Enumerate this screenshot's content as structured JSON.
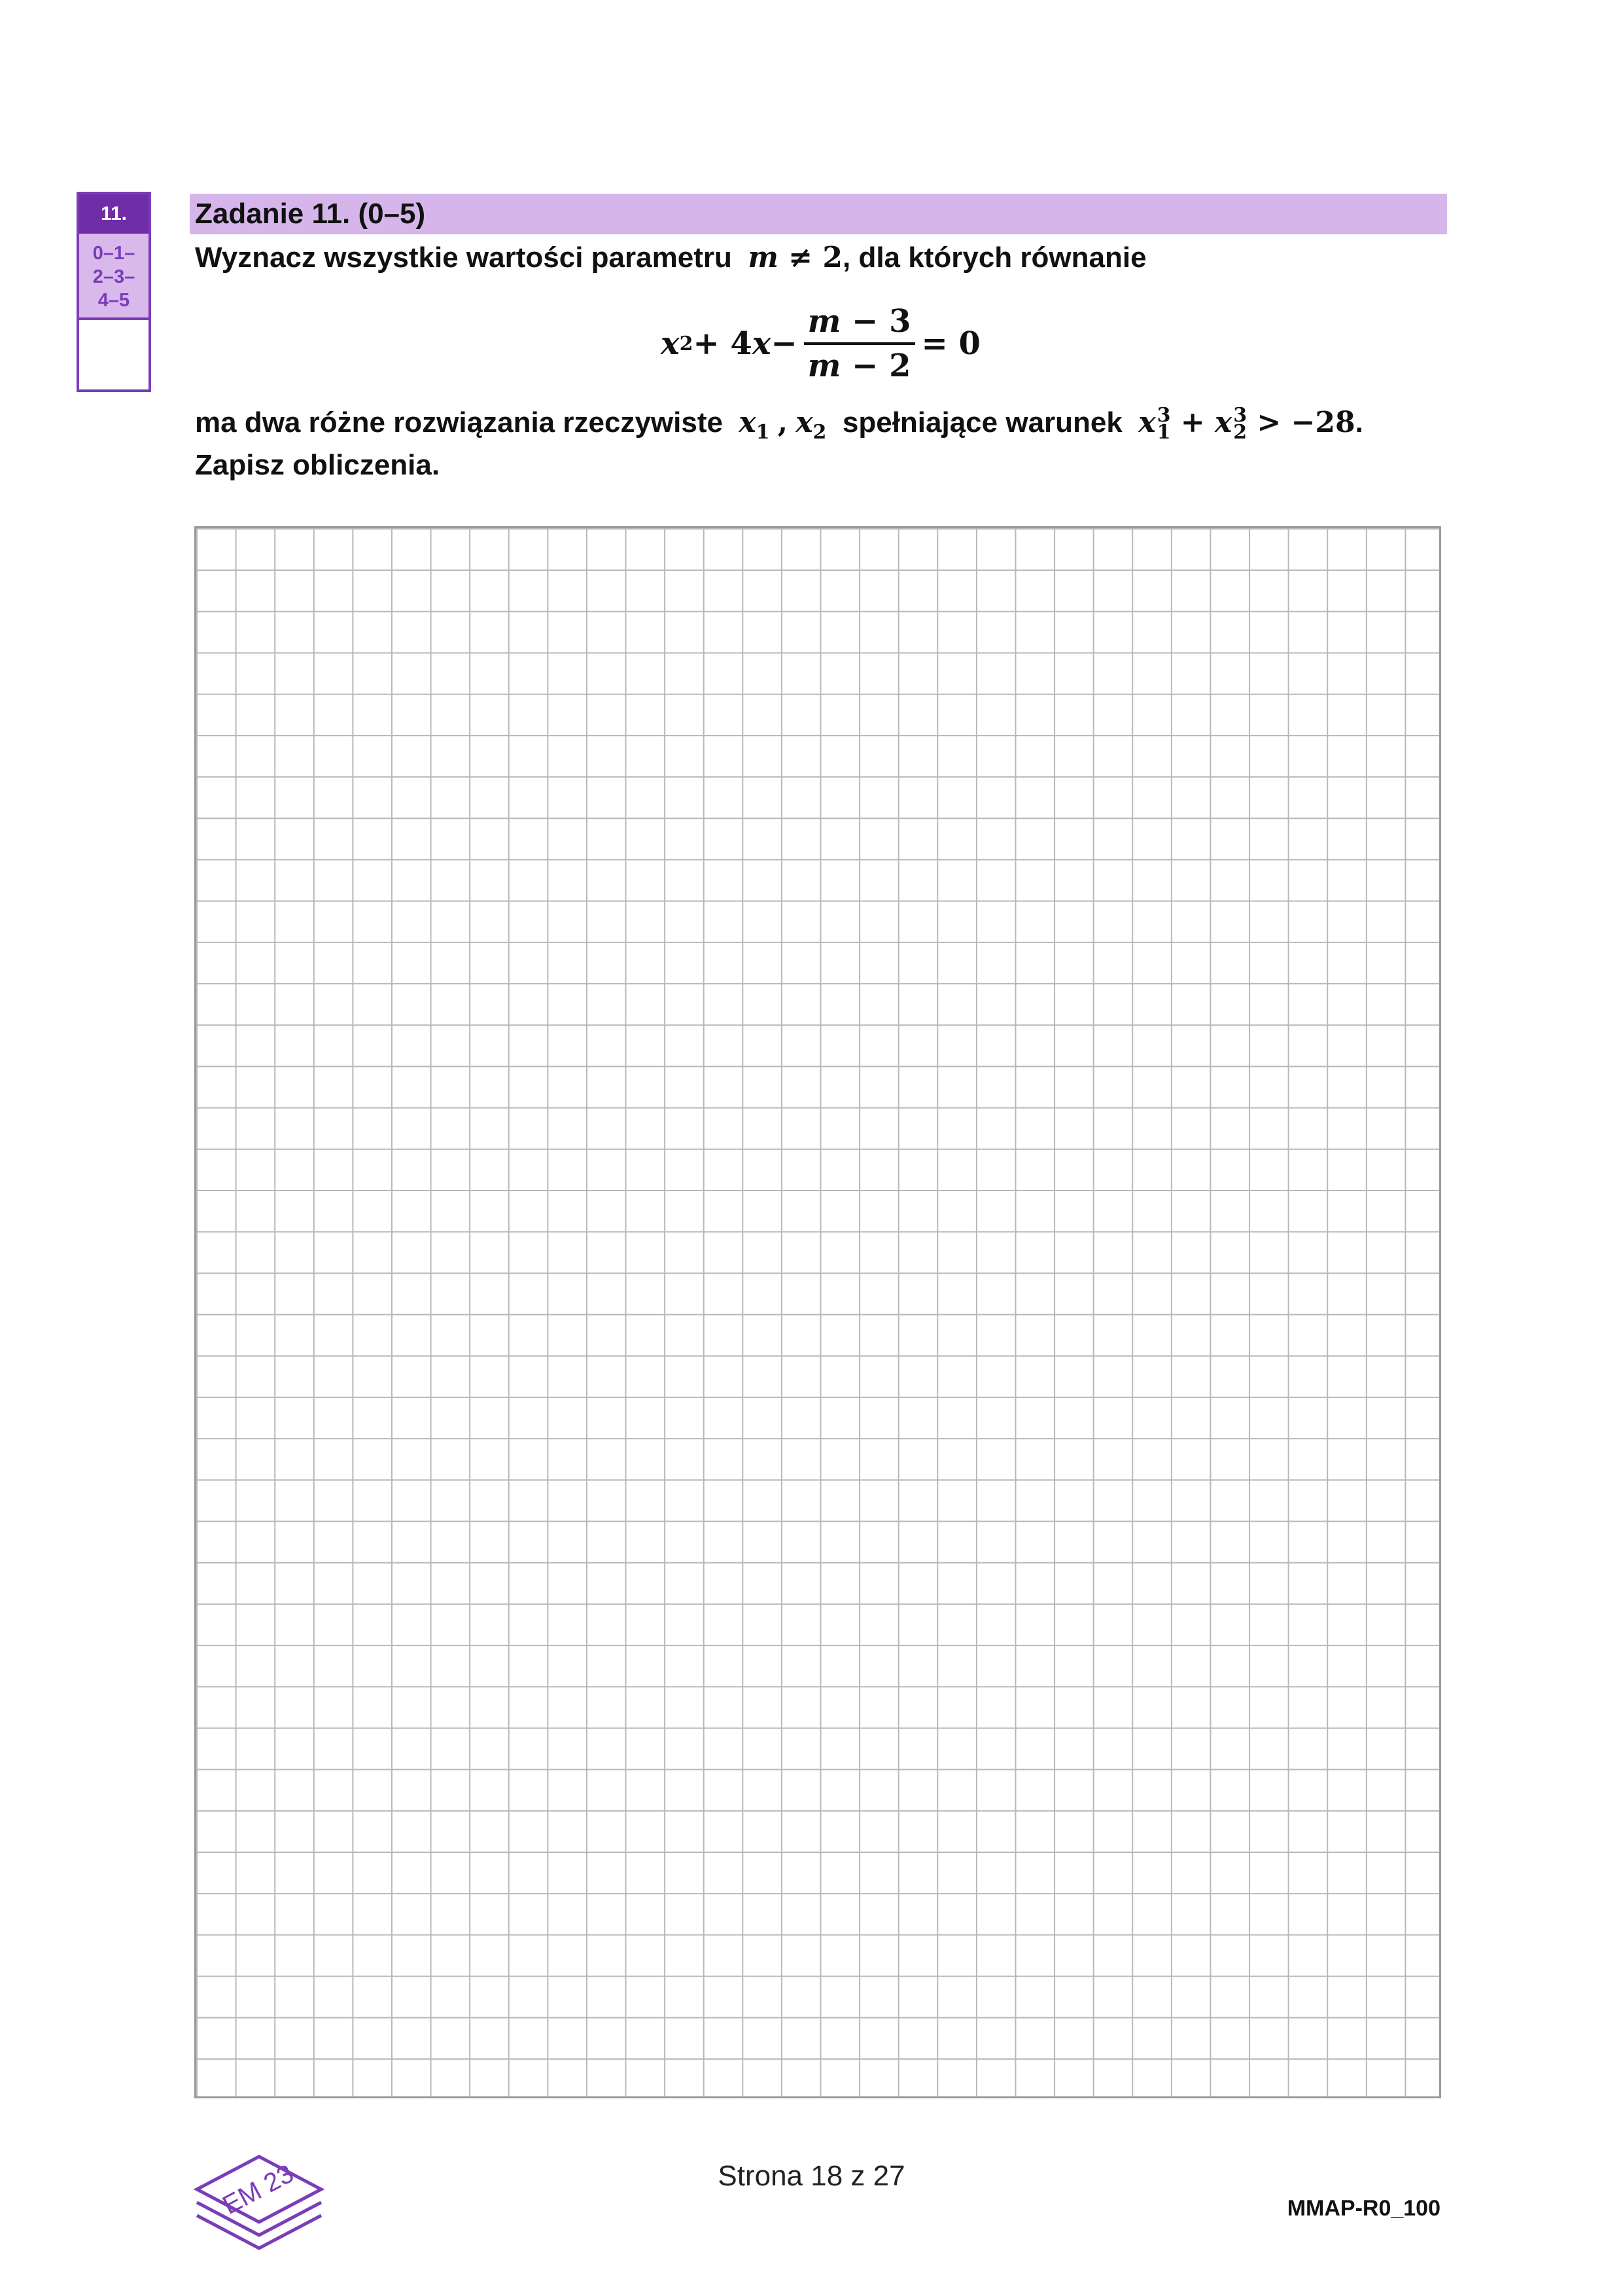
{
  "score": {
    "number": "11.",
    "ranges": [
      "0–1–",
      "2–3–",
      "4–5"
    ]
  },
  "task": {
    "header": "Zadanie 11. (0–5)",
    "line1_prefix": "Wyznacz wszystkie wartości parametru",
    "line1_math_m": "m",
    "line1_math_neq": " ≠ 2",
    "line1_suffix": ", dla których równanie",
    "equation": {
      "lhs_x": "x",
      "lhs_sq": "2",
      "lhs_mid": " + 4",
      "lhs_x2": "x",
      "minus": " −",
      "num_m": "m",
      "num_rest": " − 3",
      "den_m": "m",
      "den_rest": " − 2",
      "rhs": "= 0"
    },
    "line2_prefix": "ma dwa różne rozwiązania rzeczywiste",
    "x1": "x",
    "x1_sub": "1",
    "comma": ",",
    "x2": "x",
    "x2_sub": "2",
    "line2_mid": "spełniające warunek",
    "cond_x1": "x",
    "cond_x1_sup": "3",
    "cond_x1_sub": "1",
    "cond_plus": " + ",
    "cond_x2": "x",
    "cond_x2_sup": "3",
    "cond_x2_sub": "2",
    "cond_rest": " > −28",
    "line2_end": ".",
    "line3": "Zapisz obliczenia."
  },
  "footer": {
    "page": "Strona 18 z 27",
    "code": "MMAP-R0_100",
    "logo_text": "EM 23"
  },
  "colors": {
    "accent": "#6f2da8",
    "header_bg": "#d5b5ea",
    "grid": "#b8b8b8"
  }
}
